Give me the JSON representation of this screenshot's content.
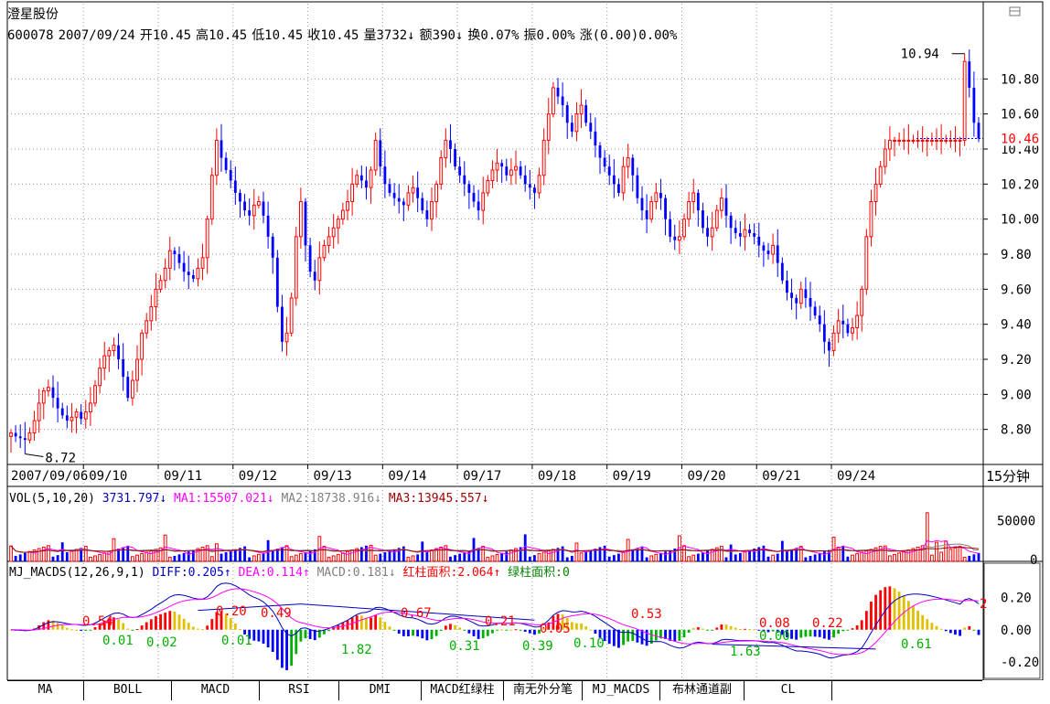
{
  "stock": {
    "name": "澄星股份",
    "code": "600078",
    "date": "2007/09/24",
    "open": "开10.45",
    "high": "高10.45",
    "low": "低10.45",
    "close": "收10.45",
    "volume": "量3732↓",
    "amount": "额390↓",
    "turnover": "换0.07%",
    "amplitude": "振0.00%",
    "change": "涨(0.00)0.00%"
  },
  "colors": {
    "up": "#ff0000",
    "down": "#0000ff",
    "ma1": "#ff00ff",
    "ma2": "#808080",
    "ma3": "#a00000",
    "yellow": "#e0c000",
    "green": "#00b000",
    "dark_red": "#c00000"
  },
  "price_panel": {
    "max_label": "10.94",
    "min_label": "8.72",
    "last_label": "10.46",
    "annotations": [],
    "window_icon": "maximize-icon"
  },
  "vol_panel": {
    "title": "VOL(5,10,20)",
    "vol": "3731.797↓",
    "ma1": "MA1:15507.021↓",
    "ma2": "MA2:18738.916↓",
    "ma3": "MA3:13945.557↓",
    "ticks": [
      "50000",
      "0"
    ]
  },
  "macd_panel": {
    "title": "MJ_MACDS(12,26,9,1)",
    "diff": "DIFF:0.205↑",
    "dea": "DEA:0.114↑",
    "macd": "MACD:0.181↓",
    "red_area": "红柱面积:2.064↑",
    "green_area": "绿柱面积:0",
    "ticks": [
      "0.20",
      "0.00",
      "-0.20"
    ],
    "labels": [
      {
        "t": "0.54",
        "c": "up",
        "x": 90,
        "y": 684
      },
      {
        "t": "0.01",
        "c": "green",
        "x": 112,
        "y": 705
      },
      {
        "t": "0.02",
        "c": "green",
        "x": 160,
        "y": 707
      },
      {
        "t": "0.20",
        "c": "up",
        "x": 236,
        "y": 673
      },
      {
        "t": "0.49",
        "c": "up",
        "x": 285,
        "y": 675
      },
      {
        "t": "0.01",
        "c": "green",
        "x": 242,
        "y": 705
      },
      {
        "t": "1.82",
        "c": "green",
        "x": 373,
        "y": 715
      },
      {
        "t": "0.67",
        "c": "up",
        "x": 438,
        "y": 675
      },
      {
        "t": "0.31",
        "c": "green",
        "x": 491,
        "y": 711
      },
      {
        "t": "0.21",
        "c": "up",
        "x": 530,
        "y": 684
      },
      {
        "t": "0.05",
        "c": "up",
        "x": 590,
        "y": 692
      },
      {
        "t": "0.39",
        "c": "green",
        "x": 571,
        "y": 711
      },
      {
        "t": "0.10",
        "c": "green",
        "x": 627,
        "y": 708
      },
      {
        "t": "0.53",
        "c": "up",
        "x": 690,
        "y": 676
      },
      {
        "t": "1.63",
        "c": "green",
        "x": 798,
        "y": 717
      },
      {
        "t": "0.08",
        "c": "up",
        "x": 830,
        "y": 686
      },
      {
        "t": "0.00",
        "c": "green",
        "x": 830,
        "y": 700
      },
      {
        "t": "0.22",
        "c": "up",
        "x": 888,
        "y": 686
      },
      {
        "t": "0.61",
        "c": "green",
        "x": 985,
        "y": 709
      },
      {
        "t": "2",
        "c": "up",
        "x": 1071,
        "y": 665
      }
    ]
  },
  "time_axis": {
    "labels": [
      "2007/09/06",
      "09/10",
      "09/11",
      "09/12",
      "09/13",
      "09/14",
      "09/17",
      "09/18",
      "09/19",
      "09/20",
      "09/21",
      "09/24"
    ],
    "period": "15分钟"
  },
  "tabs": [
    "MA",
    "BOLL",
    "MACD",
    "RSI",
    "DMI",
    "MACD红绿柱",
    "南无外分笔",
    "MJ_MACDS",
    "布林通道副",
    "CL",
    ""
  ],
  "chart_data": {
    "type": "candlestick",
    "title": "",
    "xlabel": "",
    "ylabel": "",
    "ylim": [
      8.6,
      11.0
    ],
    "yticks": [
      8.8,
      9.0,
      9.2,
      9.4,
      9.6,
      9.8,
      10.0,
      10.2,
      10.4,
      10.6,
      10.8
    ],
    "bars_per_day": 16,
    "close_series": [
      8.78,
      8.76,
      8.75,
      8.74,
      8.78,
      8.85,
      8.95,
      9.02,
      9.04,
      8.98,
      8.92,
      8.88,
      8.85,
      8.87,
      8.9,
      8.86,
      8.9,
      8.95,
      9.05,
      9.15,
      9.22,
      9.25,
      9.28,
      9.2,
      9.1,
      8.98,
      9.08,
      9.2,
      9.35,
      9.42,
      9.5,
      9.6,
      9.65,
      9.72,
      9.82,
      9.8,
      9.75,
      9.7,
      9.68,
      9.66,
      9.72,
      9.78,
      10.0,
      10.25,
      10.45,
      10.35,
      10.28,
      10.22,
      10.15,
      10.1,
      10.05,
      10.02,
      10.08,
      10.1,
      10.02,
      9.9,
      9.78,
      9.5,
      9.3,
      9.35,
      9.55,
      9.9,
      10.1,
      9.85,
      9.7,
      9.65,
      9.78,
      9.85,
      9.9,
      9.95,
      10.0,
      10.05,
      10.1,
      10.2,
      10.25,
      10.22,
      10.18,
      10.28,
      10.45,
      10.3,
      10.2,
      10.15,
      10.12,
      10.1,
      10.08,
      10.15,
      10.18,
      10.12,
      10.05,
      10.0,
      10.1,
      10.2,
      10.35,
      10.45,
      10.4,
      10.3,
      10.25,
      10.2,
      10.15,
      10.1,
      10.05,
      10.15,
      10.22,
      10.28,
      10.32,
      10.3,
      10.25,
      10.28,
      10.3,
      10.25,
      10.2,
      10.18,
      10.15,
      10.25,
      10.45,
      10.6,
      10.75,
      10.7,
      10.65,
      10.55,
      10.5,
      10.6,
      10.65,
      10.55,
      10.5,
      10.42,
      10.35,
      10.3,
      10.25,
      10.2,
      10.15,
      10.3,
      10.35,
      10.25,
      10.12,
      10.05,
      10.0,
      10.1,
      10.15,
      10.12,
      10.0,
      9.9,
      9.88,
      9.9,
      10.0,
      10.1,
      10.15,
      10.05,
      9.95,
      9.9,
      9.95,
      10.05,
      10.12,
      10.02,
      9.95,
      9.92,
      9.9,
      9.94,
      9.92,
      9.9,
      9.85,
      9.82,
      9.8,
      9.85,
      9.75,
      9.65,
      9.58,
      9.55,
      9.52,
      9.6,
      9.55,
      9.5,
      9.45,
      9.4,
      9.3,
      9.25,
      9.35,
      9.42,
      9.4,
      9.35,
      9.38,
      9.45,
      9.6,
      9.9,
      10.1,
      10.2,
      10.3,
      10.4,
      10.45,
      10.45,
      10.45,
      10.45,
      10.45,
      10.45,
      10.45,
      10.45,
      10.45,
      10.45,
      10.45,
      10.45,
      10.45,
      10.45,
      10.45,
      10.45,
      10.9,
      10.75,
      10.55,
      10.46
    ],
    "volume_ylim": [
      0,
      70000
    ],
    "macd_ylim": [
      -0.28,
      0.3
    ]
  }
}
